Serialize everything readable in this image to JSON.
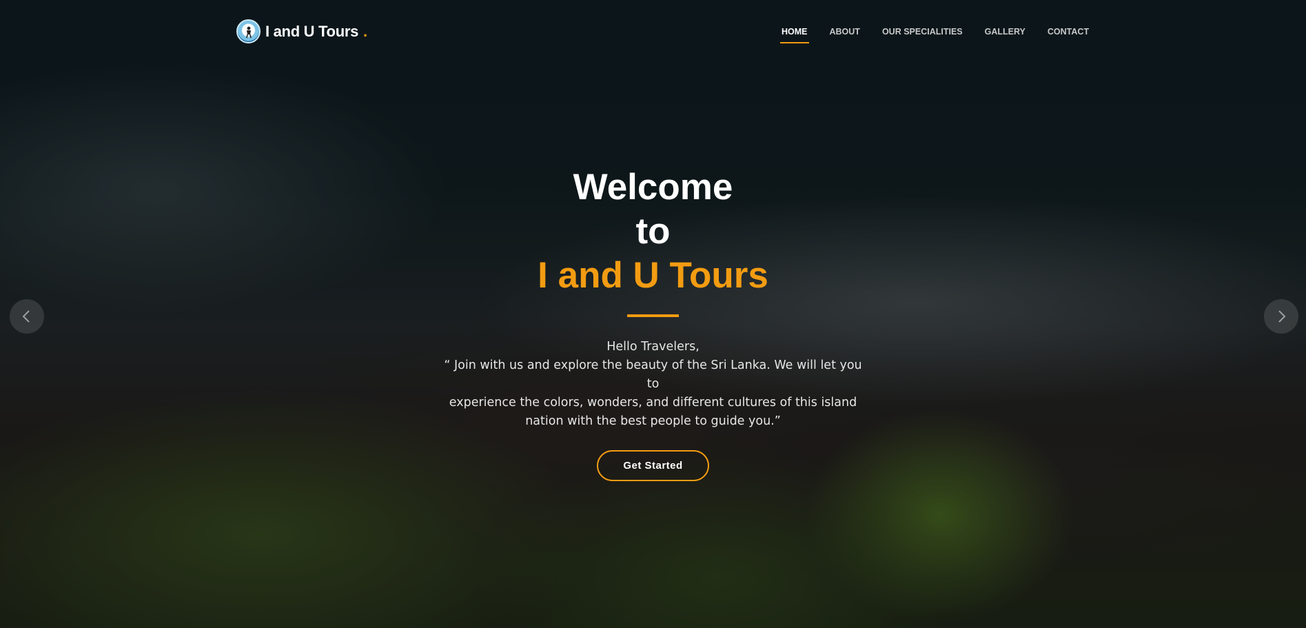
{
  "header": {
    "logo_text": "I and U Tours",
    "logo_dot": ".",
    "logo_icon": "traveler-logo-icon"
  },
  "nav": {
    "items": [
      {
        "label": "HOME",
        "active": true
      },
      {
        "label": "ABOUT",
        "active": false
      },
      {
        "label": "OUR SPECIALITIES",
        "active": false
      },
      {
        "label": "GALLERY",
        "active": false
      },
      {
        "label": "CONTACT",
        "active": false
      }
    ]
  },
  "hero": {
    "title_line1": "Welcome",
    "title_line2": "to",
    "title_brand": "I and U Tours",
    "greeting": "Hello Travelers,",
    "quote_line1": "“ Join with us and explore the beauty of the Sri Lanka. We will let you to",
    "quote_line2": "experience the colors, wonders, and different cultures of this island",
    "quote_line3": "nation with the best people to guide you.”",
    "cta_label": "Get Started"
  },
  "carousel": {
    "prev_icon": "chevron-left-icon",
    "next_icon": "chevron-right-icon"
  },
  "colors": {
    "accent": "#f39c12",
    "text": "#ffffff"
  }
}
